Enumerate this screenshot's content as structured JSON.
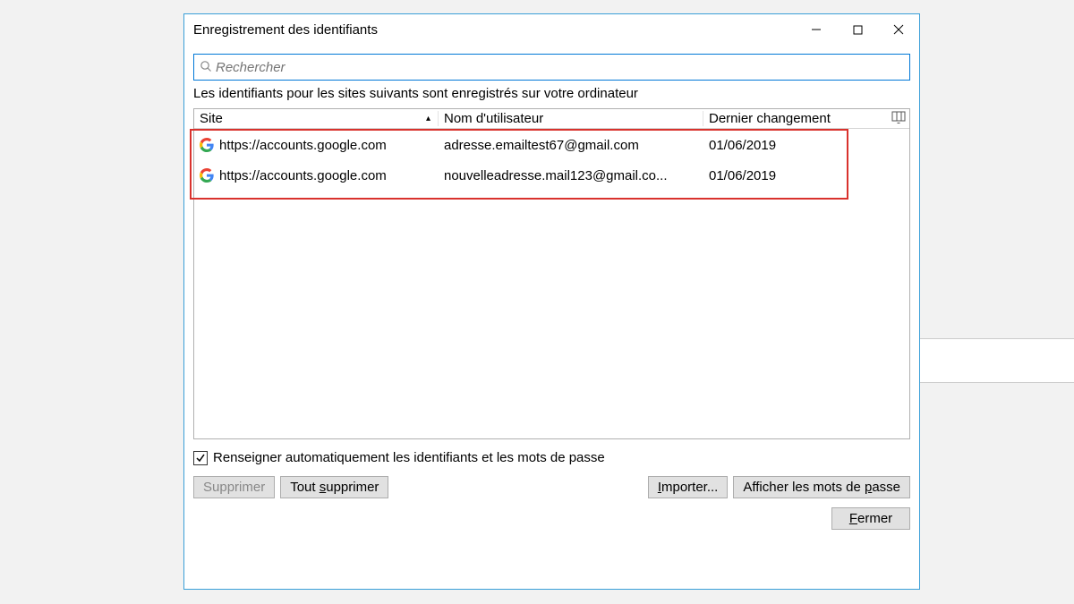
{
  "window": {
    "title": "Enregistrement des identifiants"
  },
  "search": {
    "placeholder": "Rechercher"
  },
  "description": "Les identifiants pour les sites suivants sont enregistrés sur votre ordinateur",
  "columns": {
    "site": "Site",
    "user": "Nom d'utilisateur",
    "date": "Dernier changement"
  },
  "rows": [
    {
      "site": "https://accounts.google.com",
      "user": "adresse.emailtest67@gmail.com",
      "date": "01/06/2019",
      "favicon": "google"
    },
    {
      "site": "https://accounts.google.com",
      "user": "nouvelleadresse.mail123@gmail.co...",
      "date": "01/06/2019",
      "favicon": "google"
    }
  ],
  "checkbox": {
    "checked": true,
    "label": "Renseigner automatiquement les identifiants et les mots de passe"
  },
  "buttons": {
    "delete": "Supprimer",
    "delete_all_pre": "Tout ",
    "delete_all_u": "s",
    "delete_all_post": "upprimer",
    "import_u": "I",
    "import_post": "mporter...",
    "show_pre": "Afficher les mots de ",
    "show_u": "p",
    "show_post": "asse",
    "close_u": "F",
    "close_post": "ermer"
  }
}
